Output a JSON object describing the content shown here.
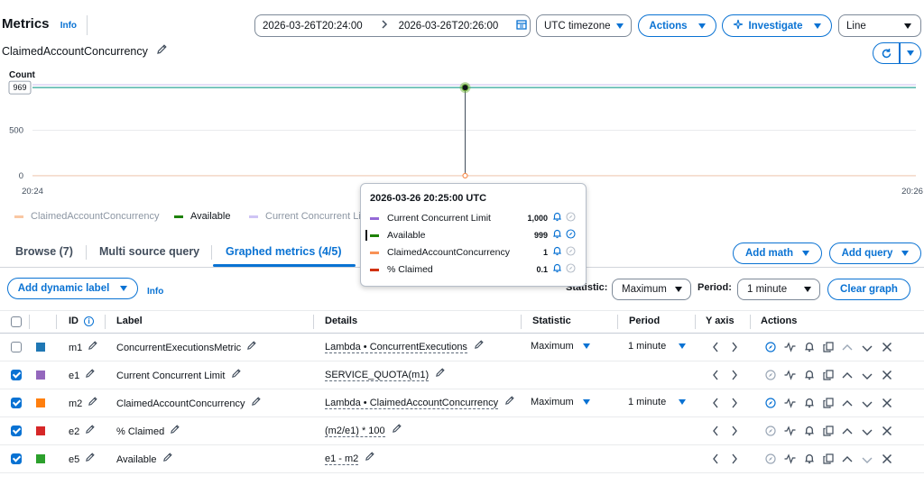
{
  "header": {
    "title": "Metrics",
    "info": "Info",
    "subtitle": "ClaimedAccountConcurrency",
    "time_start": "2026-03-26T20:24:00",
    "time_end": "2026-03-26T20:26:00",
    "timezone": "UTC timezone",
    "actions": "Actions",
    "investigate": "Investigate",
    "chart_type": "Line"
  },
  "chart_data": {
    "type": "line",
    "ylabel": "Count",
    "x_ticks": [
      "20:24",
      "20:26"
    ],
    "y_ticks": [
      0,
      500
    ],
    "ylim": [
      0,
      1000
    ],
    "highlighted_value_label": "969",
    "series": [
      {
        "name": "ClaimedAccountConcurrency",
        "color": "#f89256",
        "values": [
          1,
          1,
          1
        ]
      },
      {
        "name": "Available",
        "color": "#2ea597",
        "values": [
          969,
          969,
          969
        ]
      },
      {
        "name": "Current Concurrent Limit",
        "color": "#8c6ce0",
        "values": [
          1000,
          1000,
          1000
        ]
      }
    ]
  },
  "legend": [
    {
      "label": "ClaimedAccountConcurrency",
      "color": "#f89256"
    },
    {
      "label": "Available",
      "color": "#1d8102"
    },
    {
      "label": "Current Concurrent Li",
      "color": "#b7a8ef"
    }
  ],
  "tooltip": {
    "title": "2026-03-26 20:25:00 UTC",
    "rows": [
      {
        "label": "Current Concurrent Limit",
        "value": "1,000",
        "color": "#9469d6"
      },
      {
        "label": "Available",
        "value": "999",
        "color": "#1d8102"
      },
      {
        "label": "ClaimedAccountConcurrency",
        "value": "1",
        "color": "#f89256"
      },
      {
        "label": "% Claimed",
        "value": "0.1",
        "color": "#d13212"
      }
    ]
  },
  "tabs": [
    {
      "label": "Browse (7)"
    },
    {
      "label": "Multi source query"
    },
    {
      "label": "Graphed metrics (4/5)"
    }
  ],
  "toolbar": {
    "add_math": "Add math",
    "add_query": "Add query",
    "add_dynamic_label": "Add dynamic label",
    "info": "Info",
    "statistic_label": "Statistic:",
    "statistic_value": "Maximum",
    "period_label": "Period:",
    "period_value": "1 minute",
    "clear_graph": "Clear graph"
  },
  "table": {
    "headers": {
      "id": "ID",
      "label": "Label",
      "details": "Details",
      "statistic": "Statistic",
      "period": "Period",
      "yaxis": "Y axis",
      "actions": "Actions"
    },
    "rows": [
      {
        "id": "m1",
        "label": "ConcurrentExecutionsMetric",
        "details": "Lambda • ConcurrentExecutions",
        "statistic": "Maximum",
        "period": "1 minute",
        "checked": false,
        "color": "#1f77b4"
      },
      {
        "id": "e1",
        "label": "Current Concurrent Limit",
        "details": "SERVICE_QUOTA(m1)",
        "statistic": "",
        "period": "",
        "checked": true,
        "color": "#9467bd"
      },
      {
        "id": "m2",
        "label": "ClaimedAccountConcurrency",
        "details": "Lambda • ClaimedAccountConcurrency",
        "statistic": "Maximum",
        "period": "1 minute",
        "checked": true,
        "color": "#ff7f0e"
      },
      {
        "id": "e2",
        "label": "% Claimed",
        "details": "(m2/e1) * 100",
        "statistic": "",
        "period": "",
        "checked": true,
        "color": "#d62728"
      },
      {
        "id": "e5",
        "label": "Available",
        "details": "e1 - m2",
        "statistic": "",
        "period": "",
        "checked": true,
        "color": "#2ca02c"
      }
    ]
  }
}
